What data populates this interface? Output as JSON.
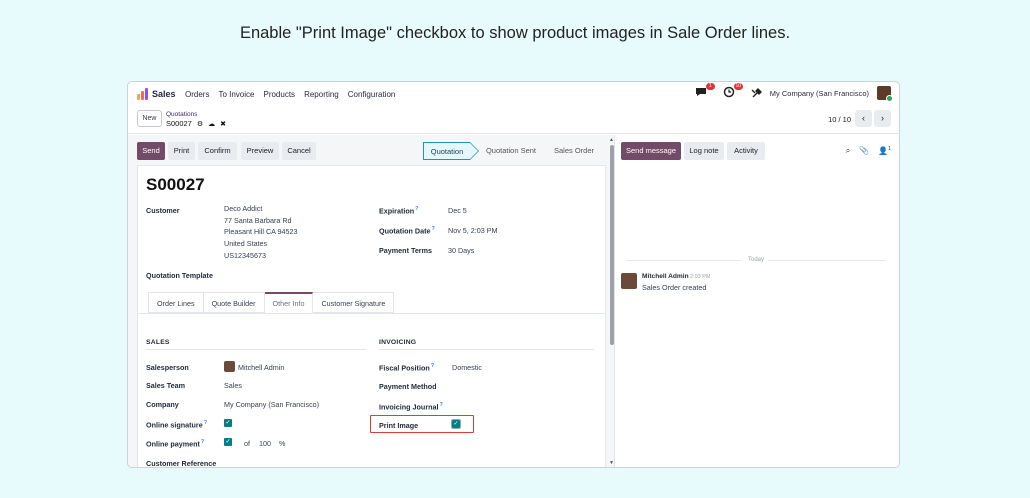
{
  "caption": "Enable \"Print Image\" checkbox to show product images in Sale Order lines.",
  "navbar": {
    "app_name": "Sales",
    "menu": [
      "Orders",
      "To Invoice",
      "Products",
      "Reporting",
      "Configuration"
    ],
    "messages_badge": "1",
    "activities_badge": "10",
    "company": "My Company (San Francisco)"
  },
  "control": {
    "new_label": "New",
    "breadcrumb_parent": "Quotations",
    "record_name": "S00027",
    "pager": "10 / 10"
  },
  "actions": {
    "send": "Send",
    "print": "Print",
    "confirm": "Confirm",
    "preview": "Preview",
    "cancel": "Cancel"
  },
  "stages": [
    "Quotation",
    "Quotation Sent",
    "Sales Order"
  ],
  "form": {
    "name": "S00027",
    "customer_label": "Customer",
    "customer_lines": [
      "Deco Addict",
      "77 Santa Barbara Rd",
      "Pleasant Hill CA 94523",
      "United States",
      "US12345673"
    ],
    "expiration_label": "Expiration",
    "expiration_value": "Dec 5",
    "quotation_date_label": "Quotation Date",
    "quotation_date_value": "Nov 5, 2:03 PM",
    "payment_terms_label": "Payment Terms",
    "payment_terms_value": "30 Days",
    "quotation_template_label": "Quotation Template",
    "help_mark": "?"
  },
  "tabs": [
    "Order Lines",
    "Quote Builder",
    "Other Info",
    "Customer Signature"
  ],
  "sales": {
    "title": "SALES",
    "salesperson_label": "Salesperson",
    "salesperson_value": "Mitchell Admin",
    "team_label": "Sales Team",
    "team_value": "Sales",
    "company_label": "Company",
    "company_value": "My Company (San Francisco)",
    "online_signature_label": "Online signature",
    "online_signature_checked": true,
    "online_payment_label": "Online payment",
    "online_payment_checked": true,
    "of_label": "of",
    "payment_percent": "100",
    "percent_sign": "%",
    "customer_reference_label": "Customer Reference"
  },
  "invoicing": {
    "title": "INVOICING",
    "fiscal_position_label": "Fiscal Position",
    "fiscal_position_value": "Domestic",
    "payment_method_label": "Payment Method",
    "invoicing_journal_label": "Invoicing Journal",
    "print_image_label": "Print Image",
    "print_image_checked": true
  },
  "chatter": {
    "send_message": "Send message",
    "log_note": "Log note",
    "activity": "Activity",
    "followers_count": "1",
    "today": "Today",
    "message_author": "Mitchell Admin",
    "message_time": "2:03 PM",
    "message_body": "Sales Order created"
  },
  "colors": {
    "brand": "#714b67",
    "checkbox": "#017e84",
    "highlight": "#e03b3b",
    "background": "#e7fbfd"
  }
}
